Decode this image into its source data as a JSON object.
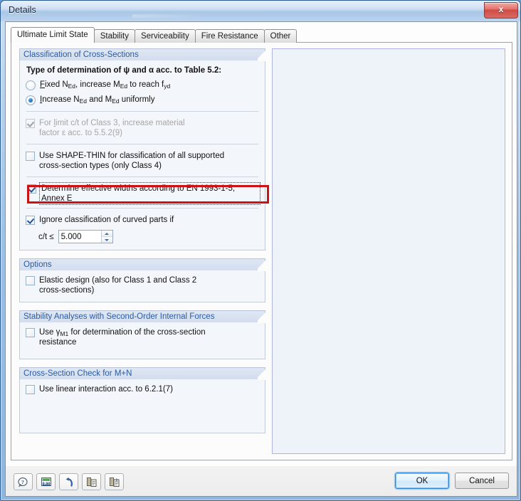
{
  "window": {
    "title": "Details",
    "close_label": "x"
  },
  "tabs": [
    {
      "label": "Ultimate Limit State",
      "active": true
    },
    {
      "label": "Stability",
      "active": false
    },
    {
      "label": "Serviceability",
      "active": false
    },
    {
      "label": "Fire Resistance",
      "active": false
    },
    {
      "label": "Other",
      "active": false
    }
  ],
  "groups": {
    "classification": {
      "header": "Classification of Cross-Sections",
      "type_label_pre": "Type of determination of ",
      "type_label_psi": "ψ",
      "type_label_mid": " and ",
      "type_label_alpha": "α",
      "type_label_post": " acc. to Table 5.2:",
      "radio_fixed": {
        "accel": "F",
        "text_a": "ixed N",
        "sub_a": "Ed",
        "text_b": ", increase M",
        "sub_b": "Ed",
        "text_c": " to reach f",
        "sub_c": "yd",
        "checked": false
      },
      "radio_increase": {
        "accel": "I",
        "text_a": "ncrease N",
        "sub_a": "Ed",
        "text_b": " and M",
        "sub_b": "Ed",
        "text_c": " uniformly",
        "checked": true
      },
      "cb_limit": {
        "accel": "l",
        "line1_pre": "For ",
        "line1_post": "imit c/t of Class 3, increase material",
        "line2": "factor ε acc. to 5.5.2(9)",
        "checked": true,
        "disabled": true
      },
      "cb_shapethin": {
        "line1": "Use SHAPE-THIN for classification of all supported",
        "line2": "cross-section types (only Class 4)",
        "checked": false
      },
      "cb_effective": {
        "label": "Determine effective widths according to EN 1993-1-5, Annex E",
        "checked": true,
        "highlighted": true,
        "highlight_color": "#cc1212"
      },
      "cb_curved": {
        "label": "Ignore classification of curved parts if",
        "checked": true
      },
      "spinner": {
        "label": "c/t ≤",
        "value": "5.000"
      }
    },
    "options": {
      "header": "Options",
      "cb_elastic": {
        "line1": "Elastic design (also for Class 1 and Class 2",
        "line2": "cross-sections)",
        "checked": false
      }
    },
    "stability": {
      "header": "Stability Analyses with Second-Order Internal Forces",
      "cb_gamma": {
        "line1_pre": "Use ",
        "line1_gamma": "γ",
        "line1_sub": "M1",
        "line1_post": " for determination of the cross-section",
        "line2": "resistance",
        "checked": false
      }
    },
    "mn_check": {
      "header": "Cross-Section Check for M+N",
      "cb_linear": {
        "label": "Use linear interaction acc. to 6.2.1(7)",
        "checked": false
      }
    }
  },
  "toolbar": [
    {
      "name": "help-icon"
    },
    {
      "name": "units-icon"
    },
    {
      "name": "undo-icon"
    },
    {
      "name": "copy-icon"
    },
    {
      "name": "paste-icon"
    }
  ],
  "buttons": {
    "ok": "OK",
    "cancel": "Cancel"
  }
}
